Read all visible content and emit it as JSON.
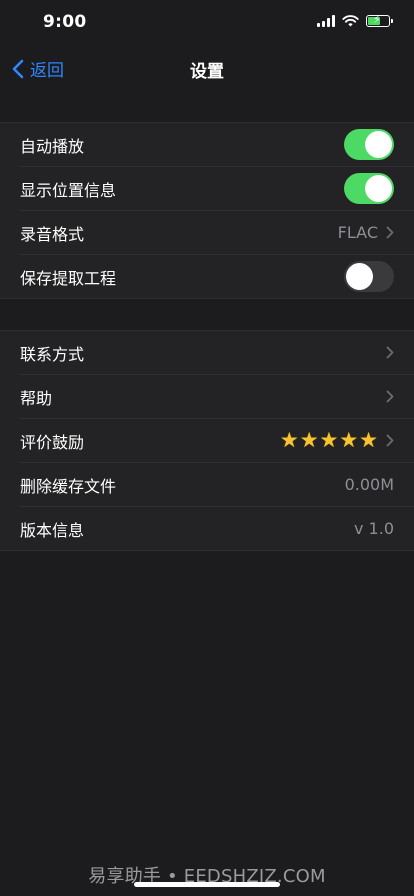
{
  "status_bar": {
    "time": "9:00"
  },
  "nav": {
    "back_label": "返回",
    "title": "设置"
  },
  "group1": [
    {
      "label": "自动播放",
      "toggle": "on"
    },
    {
      "label": "显示位置信息",
      "toggle": "on"
    },
    {
      "label": "录音格式",
      "value": "FLAC"
    },
    {
      "label": "保存提取工程",
      "toggle": "off"
    }
  ],
  "group2": [
    {
      "label": "联系方式"
    },
    {
      "label": "帮助"
    },
    {
      "label": "评价鼓励",
      "rating": 5
    },
    {
      "label": "删除缓存文件",
      "value": "0.00M"
    },
    {
      "label": "版本信息",
      "value": "v 1.0"
    }
  ],
  "watermark": "易享助手 • EEDSHZJZ.COM",
  "colors": {
    "accent": "#2f86ff",
    "toggle_on": "#4cd964",
    "background": "#1c1c1e",
    "row_bg": "#232325",
    "star": "#f7c431"
  }
}
